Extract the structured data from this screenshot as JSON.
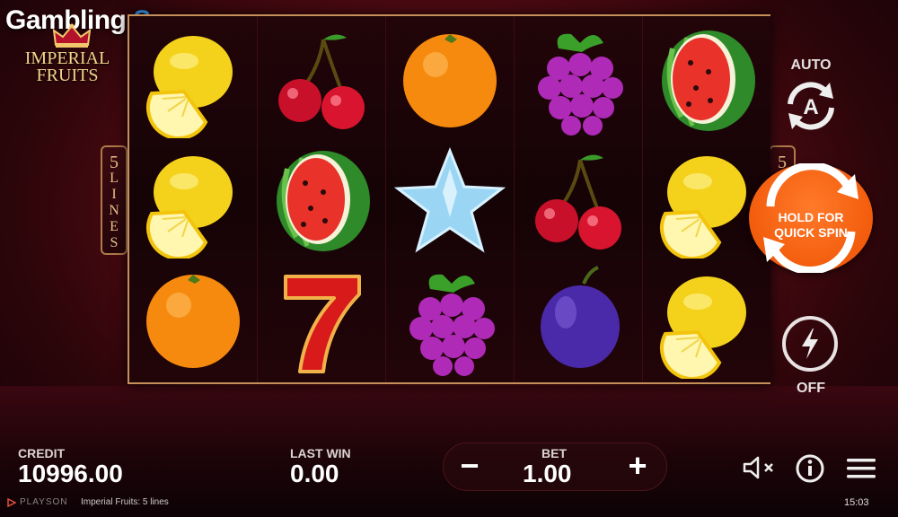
{
  "watermark": {
    "part1": "Gambling",
    "part2": "Space"
  },
  "logo": {
    "line1": "IMPERIAL",
    "line2": "FRUITS"
  },
  "side_label": {
    "number": "5",
    "word_letters": [
      "L",
      "I",
      "N",
      "E",
      "S"
    ],
    "right_number": "5"
  },
  "reels": [
    [
      "lemon",
      "lemon",
      "orange"
    ],
    [
      "cherry",
      "watermelon",
      "seven"
    ],
    [
      "orange",
      "star",
      "grapes"
    ],
    [
      "grapes",
      "cherry",
      "plum"
    ],
    [
      "watermelon",
      "lemon",
      "lemon"
    ]
  ],
  "controls": {
    "auto_label": "AUTO",
    "auto_letter": "A",
    "spin_line1": "HOLD FOR",
    "spin_line2": "QUICK SPIN",
    "turbo_label": "OFF"
  },
  "bottom": {
    "credit_label": "CREDIT",
    "credit_value": "10996.00",
    "last_win_label": "LAST WIN",
    "last_win_value": "0.00",
    "bet_label": "BET",
    "bet_value": "1.00",
    "minus": "−",
    "plus": "+"
  },
  "footer": {
    "provider": "PLAYSON",
    "game_title": "Imperial Fruits: 5 lines",
    "clock": "15:03"
  },
  "colors": {
    "accent": "#f25c0c",
    "frame": "#c6905a",
    "watermark_blue": "#3aa0ff"
  }
}
